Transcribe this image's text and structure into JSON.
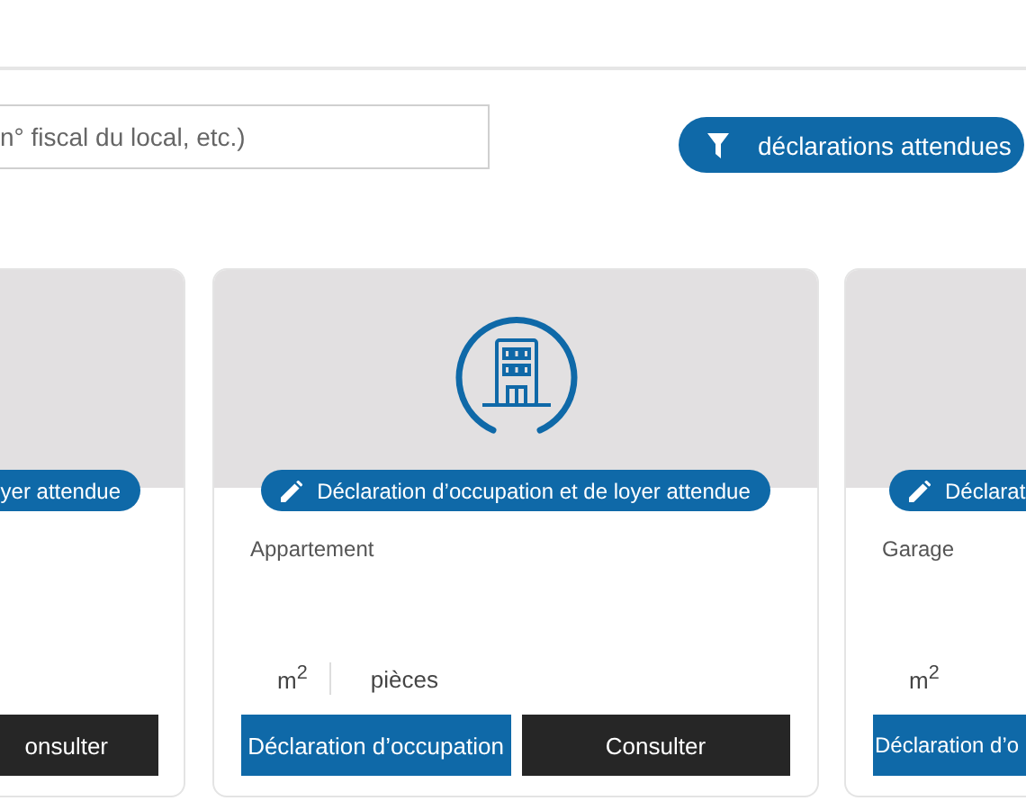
{
  "search": {
    "placeholder": "n° fiscal du local, etc.)"
  },
  "filter_button": {
    "label": "déclarations attendues"
  },
  "cards": [
    {
      "kind": "partial_left",
      "badge": "yer attendue",
      "buttons": [
        {
          "kind": "consult",
          "label": "onsulter"
        }
      ]
    },
    {
      "kind": "full",
      "badge": "Déclaration d’occupation et de loyer attendue",
      "type": "Appartement",
      "area_unit": "m$^{2}$",
      "rooms_unit": "pièces",
      "buttons": [
        {
          "kind": "declare",
          "label": "Déclaration d’occupation"
        },
        {
          "kind": "consult",
          "label": "Consulter"
        }
      ]
    },
    {
      "kind": "partial_right",
      "badge": "Déclarat",
      "type": "Garage",
      "area_unit": "m$^{2}$",
      "buttons": [
        {
          "kind": "declare",
          "label": "Déclaration d’o"
        }
      ]
    }
  ]
}
